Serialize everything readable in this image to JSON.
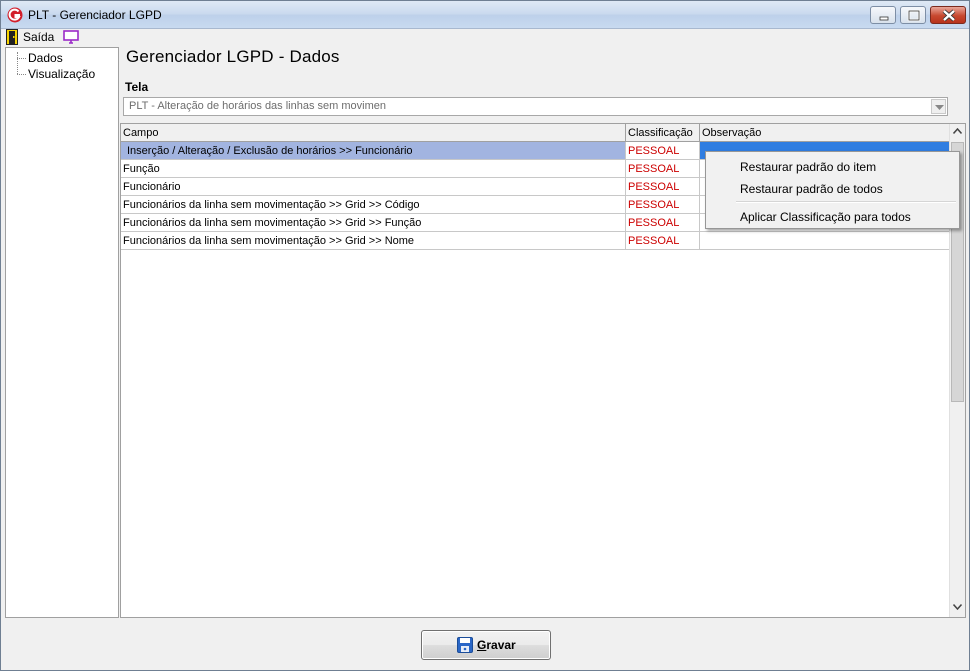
{
  "window": {
    "title": "PLT - Gerenciador LGPD",
    "minimize_icon": "minimize-icon",
    "maximize_icon": "restore-icon",
    "close_icon": "close-icon"
  },
  "menubar": {
    "exit_label": "Saída",
    "exit_icon": "door-exit-icon",
    "screen_icon": "monitor-icon"
  },
  "tree": {
    "items": [
      {
        "label": "Dados"
      },
      {
        "label": "Visualização"
      }
    ]
  },
  "main": {
    "title": "Gerenciador LGPD - Dados",
    "tela_label": "Tela",
    "tela_value": "PLT - Alteração de horários das linhas sem movimen"
  },
  "grid": {
    "columns": [
      "Campo",
      "Classificação",
      "Observação"
    ],
    "rows": [
      {
        "campo": "Inserção / Alteração / Exclusão de horários >> Funcionário",
        "classificacao": "PESSOAL",
        "observacao": ""
      },
      {
        "campo": "Função",
        "classificacao": "PESSOAL",
        "observacao": ""
      },
      {
        "campo": "Funcionário",
        "classificacao": "PESSOAL",
        "observacao": ""
      },
      {
        "campo": "Funcionários da linha sem movimentação >> Grid >> Código",
        "classificacao": "PESSOAL",
        "observacao": ""
      },
      {
        "campo": "Funcionários da linha sem movimentação >> Grid >> Função",
        "classificacao": "PESSOAL",
        "observacao": ""
      },
      {
        "campo": "Funcionários da linha sem movimentação >> Grid >> Nome",
        "classificacao": "PESSOAL",
        "observacao": ""
      }
    ]
  },
  "context_menu": {
    "items": [
      "Restaurar padrão do item",
      "Restaurar padrão de todos",
      "Aplicar Classificação para todos"
    ]
  },
  "footer": {
    "save_label": "Gravar",
    "save_icon": "floppy-disk-icon"
  },
  "colors": {
    "classification_text": "#cc0000",
    "selected_row": "#a2b4e0",
    "selected_cell": "#2f7de1"
  }
}
